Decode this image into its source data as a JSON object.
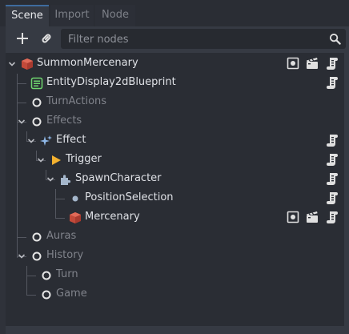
{
  "tabs": [
    {
      "label": "Scene",
      "active": true
    },
    {
      "label": "Import",
      "active": false
    },
    {
      "label": "Node",
      "active": false
    }
  ],
  "toolbar": {
    "add_icon": "plus-icon",
    "link_icon": "link-icon",
    "filter_placeholder": "Filter nodes",
    "search_icon": "search-icon"
  },
  "tree": [
    {
      "label": "SummonMercenary",
      "icon": "cube-icon",
      "expanded": true,
      "dim": false,
      "right_icons": [
        "visibility-icon",
        "clapper-icon",
        "script-icon"
      ]
    },
    {
      "label": "EntityDisplay2dBlueprint",
      "icon": "text-list-icon",
      "dim": false,
      "right_icons": [
        "script-icon"
      ]
    },
    {
      "label": "TurnActions",
      "icon": "circle-icon",
      "dim": true,
      "right_icons": []
    },
    {
      "label": "Effects",
      "icon": "circle-icon",
      "expanded": true,
      "dim": true,
      "right_icons": []
    },
    {
      "label": "Effect",
      "icon": "sparkle-icon",
      "expanded": true,
      "dim": false,
      "right_icons": [
        "script-icon"
      ]
    },
    {
      "label": "Trigger",
      "icon": "play-triangle-icon",
      "expanded": true,
      "dim": false,
      "right_icons": [
        "script-icon"
      ]
    },
    {
      "label": "SpawnCharacter",
      "icon": "puzzle-icon",
      "expanded": true,
      "dim": false,
      "right_icons": [
        "script-icon"
      ]
    },
    {
      "label": "PositionSelection",
      "icon": "dot-icon",
      "dim": false,
      "right_icons": [
        "script-icon"
      ]
    },
    {
      "label": "Mercenary",
      "icon": "cube-icon",
      "dim": false,
      "right_icons": [
        "visibility-icon",
        "clapper-icon",
        "script-icon"
      ]
    },
    {
      "label": "Auras",
      "icon": "circle-icon",
      "dim": true,
      "right_icons": []
    },
    {
      "label": "History",
      "icon": "circle-icon",
      "expanded": true,
      "dim": true,
      "right_icons": []
    },
    {
      "label": "Turn",
      "icon": "circle-icon",
      "dim": true,
      "right_icons": []
    },
    {
      "label": "Game",
      "icon": "circle-icon",
      "dim": true,
      "right_icons": []
    }
  ],
  "colors": {
    "background": "#2f323a",
    "tree_background": "#2a2d34",
    "active_tab_accent": "#3e6b9e",
    "dim_text": "#80838b",
    "node_cube": "#c24a3a",
    "sparkle": "#8fb8e8",
    "trigger": "#f3b12f",
    "text_list": "#6fd66f"
  }
}
